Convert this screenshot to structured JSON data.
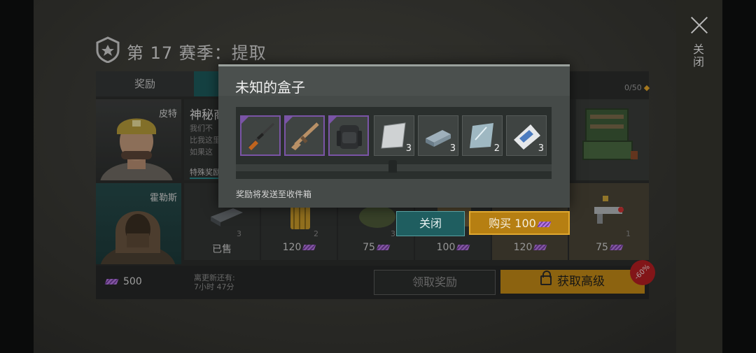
{
  "header": {
    "title": "第 17 赛季：提取",
    "close_label": "关闭"
  },
  "tabs": {
    "reward": "奖励"
  },
  "progress": {
    "count": "0/50"
  },
  "characters": [
    {
      "name": "皮特"
    },
    {
      "name": "霍勒斯"
    }
  ],
  "mission": {
    "title": "神秘商",
    "desc_lines": [
      "我们不",
      "比我这里",
      "如果这"
    ],
    "special": "特殊奖励"
  },
  "shop": {
    "items": [
      {
        "price": "已售",
        "qty": "3"
      },
      {
        "price": "120",
        "qty": "2"
      },
      {
        "price": "75",
        "qty": "3"
      },
      {
        "price": "100",
        "qty": ""
      },
      {
        "price": "120",
        "qty": ""
      },
      {
        "price": "75",
        "qty": "1"
      }
    ]
  },
  "bottom": {
    "balance": "500",
    "refresh_label": "离更新还有:",
    "refresh_time": "7小时 47分",
    "claim_label": "领取奖励",
    "upgrade_label": "获取高级",
    "discount": "-60%"
  },
  "dialog": {
    "title": "未知的盒子",
    "note": "奖励将发送至收件箱",
    "items": [
      {
        "icon": "sniper-rifle-icon",
        "count": "",
        "rarity": "epic"
      },
      {
        "icon": "assault-rifle-icon",
        "count": "",
        "rarity": "epic"
      },
      {
        "icon": "backpack-icon",
        "count": "",
        "rarity": "epic"
      },
      {
        "icon": "steel-plate-icon",
        "count": "3",
        "rarity": "common"
      },
      {
        "icon": "metal-ingot-icon",
        "count": "3",
        "rarity": "common"
      },
      {
        "icon": "glass-pane-icon",
        "count": "2",
        "rarity": "common"
      },
      {
        "icon": "cement-bag-icon",
        "count": "3",
        "rarity": "common"
      }
    ],
    "close_label": "关闭",
    "buy_label": "购买",
    "buy_price": "100"
  },
  "colors": {
    "teal": "#1f5e60",
    "gold": "#c28a17",
    "epic": "#7a54a6",
    "discount": "#b51e22"
  }
}
